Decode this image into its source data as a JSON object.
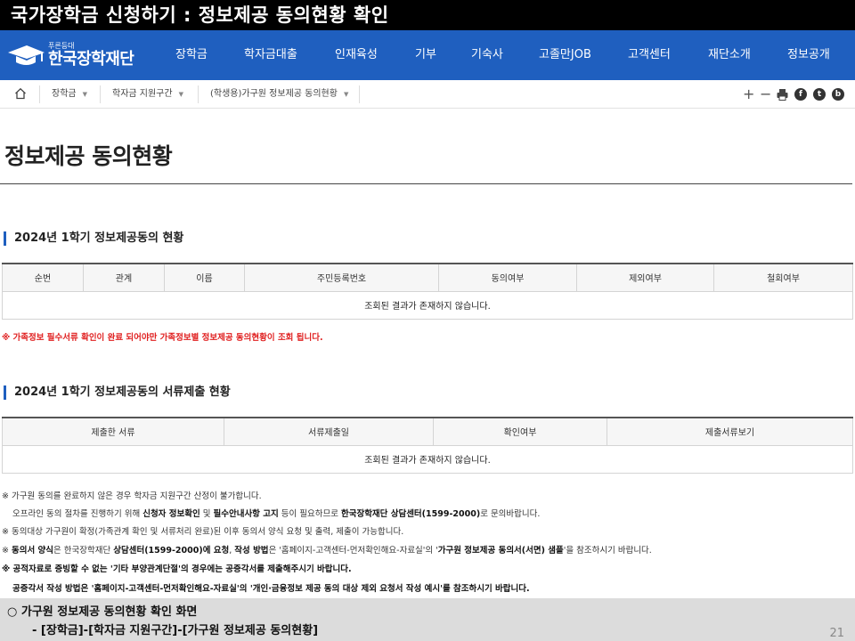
{
  "slide": {
    "title": "국가장학금 신청하기 : 정보제공 동의현황 확인",
    "caption_line1": "○ 가구원 정보제공 동의현황 확인 화면",
    "caption_line2": "- [장학금]-[학자금 지원구간]-[가구원 정보제공 동의현황]",
    "page_number": "21"
  },
  "header": {
    "logo_sub": "푸른등대",
    "logo_main": "한국장학재단",
    "menu": [
      "장학금",
      "학자금대출",
      "인재육성",
      "기부",
      "기숙사",
      "고졸만JOB",
      "고객센터",
      "재단소개",
      "정보공개"
    ]
  },
  "breadcrumb": {
    "items": [
      "장학금",
      "학자금 지원구간",
      "(학생용)가구원 정보제공 동의현황"
    ],
    "tools": [
      "+",
      "−",
      "print-icon",
      "facebook-icon",
      "twitter-icon",
      "blog-icon"
    ]
  },
  "page": {
    "title": "정보제공 동의현황"
  },
  "section1": {
    "title": "2024년 1학기 정보제공동의 현황",
    "columns": [
      "순번",
      "관계",
      "이름",
      "주민등록번호",
      "동의여부",
      "제외여부",
      "철회여부"
    ],
    "empty_message": "조회된 결과가 존재하지 않습니다.",
    "warning": "※ 가족정보 필수서류 확인이 완료 되어야만 가족정보별 정보제공 동의현황이 조회 됩니다."
  },
  "section2": {
    "title": "2024년 1학기 정보제공동의 서류제출 현황",
    "columns": [
      "제출한 서류",
      "서류제출일",
      "확인여부",
      "제출서류보기"
    ],
    "empty_message": "조회된 결과가 존재하지 않습니다."
  },
  "notes": {
    "n1": "※ 가구원 동의를 완료하지 않은 경우 학자금 지원구간 산정이 불가합니다.",
    "n2_a": "오프라인 동의 절차를 진행하기 위해 ",
    "n2_b": "신청자 정보확인",
    "n2_c": " 및 ",
    "n2_d": "필수안내사항 고지",
    "n2_e": " 등이 필요하므로 ",
    "n2_f": "한국장학재단 상담센터(1599-2000)",
    "n2_g": "로 문의바랍니다.",
    "n3": "※ 동의대상 가구원이 확정(가족관계 확인 및 서류처리 완료)된 이후 동의서 양식 요청 및 출력, 제출이 가능합니다.",
    "n4_a": "※ ",
    "n4_b": "동의서 양식",
    "n4_c": "은 한국장학재단 ",
    "n4_d": "상담센터(1599-2000)에 요청",
    "n4_e": ", ",
    "n4_f": "작성 방법",
    "n4_g": "은 '홈페이지-고객센터-먼저확인해요-자료실'의 '",
    "n4_h": "가구원 정보제공 동의서(서면) 샘플",
    "n4_i": "'을 참조하시기 바랍니다.",
    "n5": "※ 공적자료로 증빙할 수 없는 '기타 부양관계단절'의 경우에는 공증각서를 제출해주시기 바랍니다.",
    "n6": "공증각서 작성 방법은 '홈페이지-고객센터-먼저확인해요-자료실'의 '개인·금융정보 제공 동의 대상 제외 요청서 작성 예시'를 참조하시기 바랍니다."
  }
}
